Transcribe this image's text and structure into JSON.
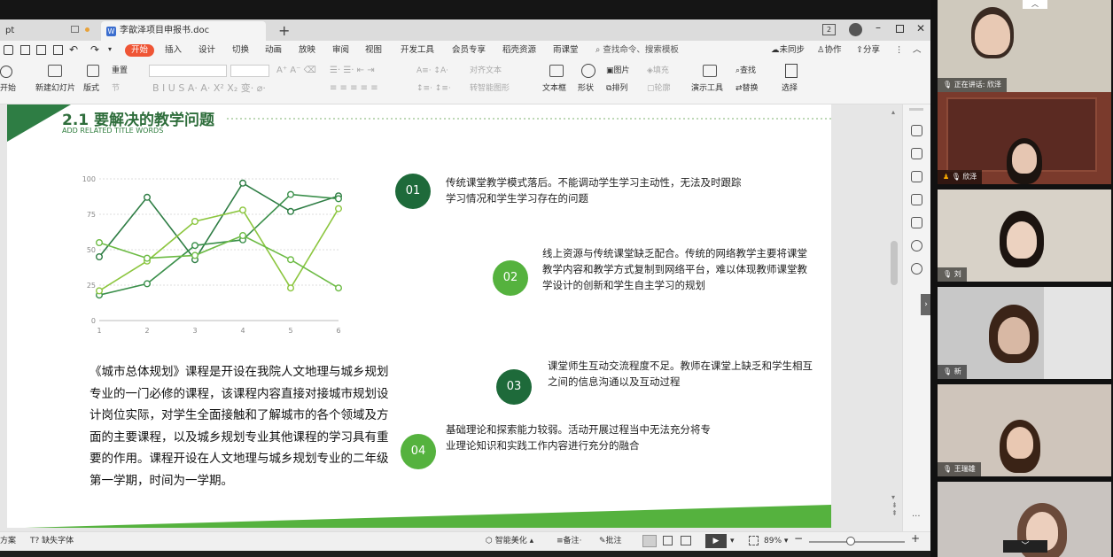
{
  "window": {
    "partial_title": "pt",
    "doc_tab": "李歆泽项目申报书.doc",
    "doc_icon": "W",
    "layout_box": "2"
  },
  "menu": {
    "items": [
      "开始",
      "插入",
      "设计",
      "切换",
      "动画",
      "放映",
      "审阅",
      "视图",
      "开发工具",
      "会员专享",
      "稻壳资源",
      "雨课堂"
    ],
    "search": "查找命令、搜索模板",
    "sync": "未同步",
    "collab": "协作",
    "share": "分享"
  },
  "ribbon": {
    "start_show": "开始",
    "new_slide": "新建幻灯片",
    "layout": "版式",
    "chapter": "节",
    "reset": "重置",
    "align_text": "对齐文本",
    "convert_smartart": "转智能图形",
    "textbox": "文本框",
    "shape": "形状",
    "picture": "图片",
    "arrange": "排列",
    "fill": "填充",
    "outline": "轮廓",
    "present_tool": "演示工具",
    "find": "查找",
    "replace": "替换",
    "select": "选择"
  },
  "slide": {
    "title": "2.1 要解决的教学问题",
    "subtitle": "ADD RELATED TITLE WORDS",
    "points": [
      {
        "num": "01",
        "color": "#1e6a3a",
        "text": "传统课堂教学模式落后。不能调动学生学习主动性，无法及时跟踪学习情况和学生学习存在的问题"
      },
      {
        "num": "02",
        "color": "#55b23e",
        "text": "线上资源与传统课堂缺乏配合。传统的网络教学主要将课堂教学内容和教学方式复制到网络平台，难以体现教师课堂教学设计的创新和学生自主学习的规划"
      },
      {
        "num": "03",
        "color": "#1e6a3a",
        "text": "课堂师生互动交流程度不足。教师在课堂上缺乏和学生相互之间的信息沟通以及互动过程"
      },
      {
        "num": "04",
        "color": "#55b23e",
        "text": "基础理论和探索能力较弱。活动开展过程当中无法充分将专业理论知识和实践工作内容进行充分的融合"
      }
    ],
    "paragraph": "《城市总体规划》课程是开设在我院人文地理与城乡规划专业的一门必修的课程，该课程内容直接对接城市规划设计岗位实际，对学生全面接触和了解城市的各个领域及方面的主要课程，以及城乡规划专业其他课程的学习具有重要的作用。课程开设在人文地理与城乡规划专业的二年级第一学期，时间为一学期。"
  },
  "chart_data": {
    "type": "line",
    "x": [
      1,
      2,
      3,
      4,
      5,
      6
    ],
    "ylim": [
      0,
      100
    ],
    "yticks": [
      0,
      25,
      50,
      75,
      100
    ],
    "grid": true,
    "series": [
      {
        "color": "#2e7d44",
        "values": [
          45,
          87,
          43,
          97,
          77,
          88
        ]
      },
      {
        "color": "#3a8f4a",
        "values": [
          18,
          26,
          53,
          57,
          89,
          86
        ]
      },
      {
        "color": "#8cc63f",
        "values": [
          21,
          42,
          70,
          78,
          23,
          79
        ]
      },
      {
        "color": "#6dbb45",
        "values": [
          55,
          44,
          46,
          60,
          43,
          23
        ]
      }
    ]
  },
  "status": {
    "left1": "方案",
    "missing_font": "缺失字体",
    "beautify": "智能美化",
    "notes": "备注",
    "comments": "批注",
    "zoom": "89%"
  },
  "video": {
    "participants": [
      {
        "name": "正在讲话: 欣泽",
        "bg": "#cfc9bd"
      },
      {
        "name": "欣泽",
        "bg": "#7a3a2c"
      },
      {
        "name": "刘",
        "bg": "#d8d2c8"
      },
      {
        "name": "新",
        "bg": "#c8c8c8"
      },
      {
        "name": "王瑞雄",
        "bg": "#cfc5bb"
      },
      {
        "name": "",
        "bg": "#c9c4c0"
      }
    ]
  }
}
